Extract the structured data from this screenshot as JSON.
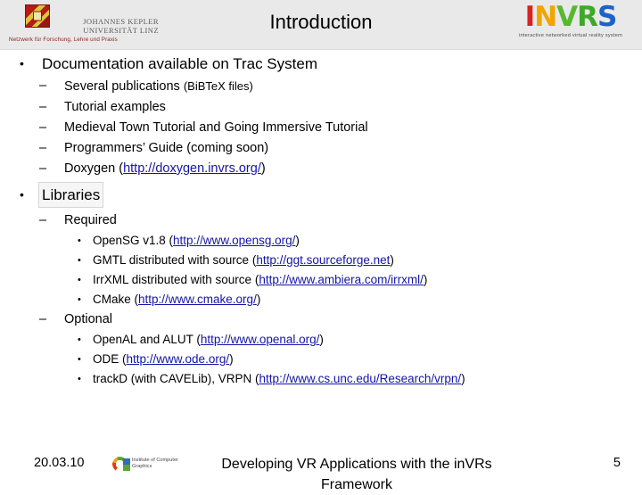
{
  "header": {
    "title": "Introduction",
    "jku_logo": {
      "name_line1": "JOHANNES KEPLER",
      "name_line2": "UNIVERSITÄT LINZ",
      "tagline": "Netzwerk für Forschung, Lehre und Praxis"
    },
    "invrs_logo": {
      "letters": [
        "I",
        "N",
        "V",
        "R",
        "S"
      ],
      "tagline": "interactive networked virtual reality system",
      "colors": {
        "i": "#d8241f",
        "n": "#f0a500",
        "v": "#58b832",
        "r": "#3fa82a",
        "s": "#1b63c4"
      }
    }
  },
  "content": {
    "doc_bullet": "Documentation available on Trac System",
    "doc_items": [
      {
        "text": "Several publications ",
        "note": "(BiBTeX files)"
      },
      {
        "text": "Tutorial examples",
        "note": ""
      },
      {
        "text": "Medieval Town Tutorial and Going Immersive Tutorial",
        "note": ""
      },
      {
        "text": "Programmers’ Guide (coming soon)",
        "note": ""
      }
    ],
    "doxygen": {
      "label": "Doxygen (",
      "link": "http://doxygen.invrs.org/",
      "close": ")"
    },
    "libraries_bullet": "Libraries",
    "required_label": "Required",
    "required_items": [
      {
        "pre": "OpenSG v1.8 (",
        "link": "http://www.opensg.org/",
        "post": ")"
      },
      {
        "pre": "GMTL distributed with source (",
        "link": "http://ggt.sourceforge.net",
        "post": ")"
      },
      {
        "pre": "IrrXML distributed with source (",
        "link": "http://www.ambiera.com/irrxml/",
        "post": ")"
      },
      {
        "pre": "CMake (",
        "link": "http://www.cmake.org/",
        "post": ")"
      }
    ],
    "optional_label": "Optional",
    "optional_items": [
      {
        "pre": "OpenAL and ALUT (",
        "link": "http://www.openal.org/",
        "post": ")"
      },
      {
        "pre": "ODE (",
        "link": "http://www.ode.org/",
        "post": ")"
      },
      {
        "pre": "trackD (with CAVELib), VRPN (",
        "link": "http://www.cs.unc.edu/Research/vrpn/",
        "post": ")"
      }
    ],
    "bullet_glyph": "•",
    "dash_glyph": "–",
    "link_color": "#1414a8"
  },
  "footer": {
    "date": "20.03.10",
    "icg_logo_text": "Institute of Computer Graphics",
    "title_line1": "Developing VR Applications with the inVRs",
    "title_line2": "Framework",
    "page_number": "5"
  }
}
